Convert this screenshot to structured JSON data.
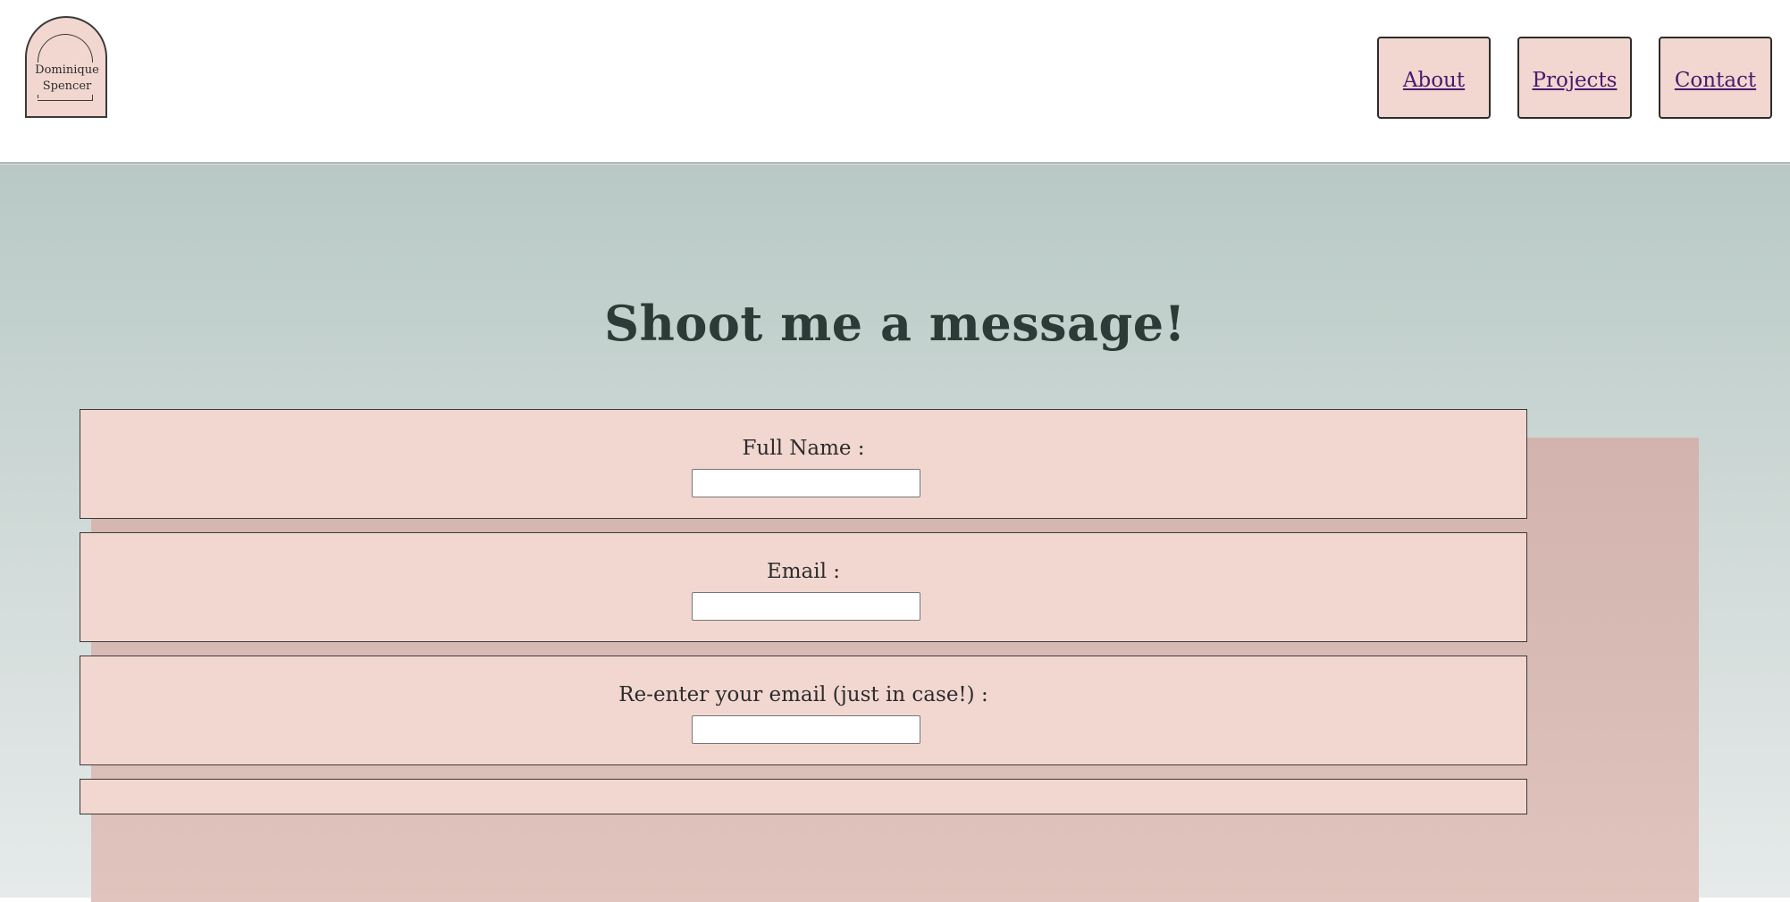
{
  "header": {
    "logo_text": "Dominique\nSpencer",
    "nav": [
      {
        "label": "About"
      },
      {
        "label": "Projects"
      },
      {
        "label": "Contact"
      }
    ]
  },
  "main": {
    "title": "Shoot me a message!",
    "form": {
      "fields": [
        {
          "label": "Full Name :",
          "value": "",
          "placeholder": ""
        },
        {
          "label": "Email :",
          "value": "",
          "placeholder": ""
        },
        {
          "label": "Re-enter your email (just in case!) :",
          "value": "",
          "placeholder": ""
        }
      ]
    }
  },
  "colors": {
    "header_bg": "#ffffff",
    "button_bg": "#f2d7d0",
    "link": "#4b1a6e",
    "title": "#2c3b36",
    "panel": "#d3b3ad",
    "field_bg": "#f2d7d1"
  }
}
